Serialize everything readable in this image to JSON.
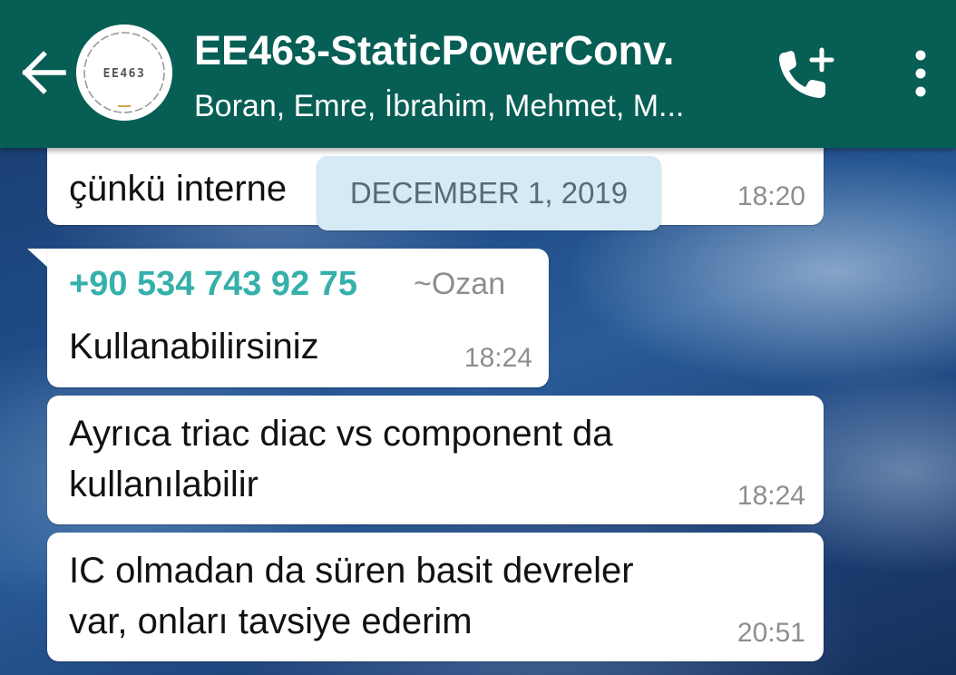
{
  "header": {
    "title": "EE463-StaticPowerConv.",
    "subtitle": "Boran, Emre, İbrahim, Mehmet, M...",
    "avatar_text": "EE463",
    "background_color": "#075e54"
  },
  "icons": {
    "back": "arrow-left-icon",
    "call": "add-call-icon",
    "menu": "more-vertical-icon"
  },
  "date_chip": "DECEMBER 1, 2019",
  "messages": [
    {
      "text_lines": [
        "çünkü interne"
      ],
      "time": "18:20"
    },
    {
      "sender_phone": "+90 534 743 92 75",
      "sender_name": "~Ozan",
      "text_lines": [
        "Kullanabilirsiniz"
      ],
      "time": "18:24"
    },
    {
      "text_lines": [
        "Ayrıca triac diac vs component da",
        "kullanılabilir"
      ],
      "time": "18:24"
    },
    {
      "text_lines": [
        "IC olmadan da süren basit devreler",
        "var, onları tavsiye ederim"
      ],
      "time": "20:51"
    }
  ],
  "colors": {
    "sender_phone": "#35b0ab",
    "timestamp": "#8e8e8e",
    "date_chip_bg": "#d5eaf4"
  }
}
